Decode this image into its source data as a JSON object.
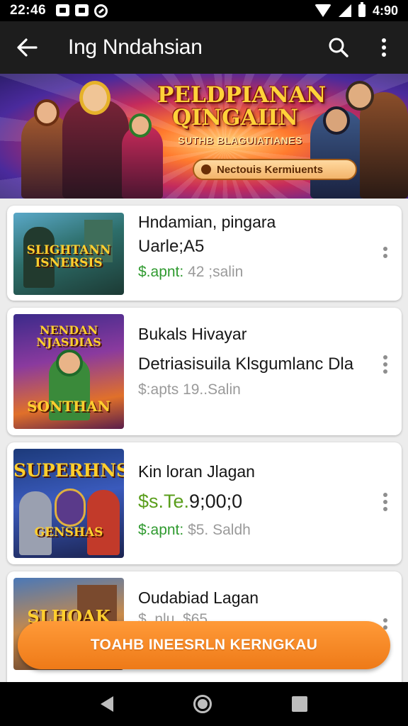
{
  "status_bar": {
    "time": "22:46",
    "battery": "4:90"
  },
  "app_bar": {
    "title": "Ing Nndahsian"
  },
  "banner": {
    "title": "PELDPIANAN QINGAIIN",
    "subtitle": "SUTHB BLAGUIATIANES",
    "pill_text": "Nectouis Kermiuents"
  },
  "items": [
    {
      "thumb_text": "SLIGHTANN ISNERSIS",
      "title": "Hndamian, pingara",
      "subtitle": "Uarle;A5",
      "meta_prefix": "$.apnt:",
      "meta_value": "42 ;salin"
    },
    {
      "thumb_text_top": "NENDAN NJASDIAS",
      "thumb_text": "SONTHAN",
      "title": "Bukals Hivayar",
      "subtitle": "Detriasisuila Klsgumlanc Dla",
      "meta_prefix": "$:apts",
      "meta_value": "19..Salin"
    },
    {
      "thumb_text": "SUPERHNS",
      "thumb_text_bottom": "GENSHAS",
      "title": "Kin loran Jlagan",
      "price_green": "$s.Te.",
      "price_dark": "9;00;0",
      "meta_prefix": "$:apnt:",
      "meta_value": "$5. Saldh"
    },
    {
      "thumb_text": "SLHOAK",
      "title": "Oudabiad Lagan",
      "subtitle": "$ .nlu, $65"
    }
  ],
  "cta": {
    "label": "TOAHB INEESRLN KERNGKAU"
  },
  "colors": {
    "accent": "#ef7d1a",
    "appbar": "#1d1d1d",
    "green": "#2f9a2f"
  }
}
